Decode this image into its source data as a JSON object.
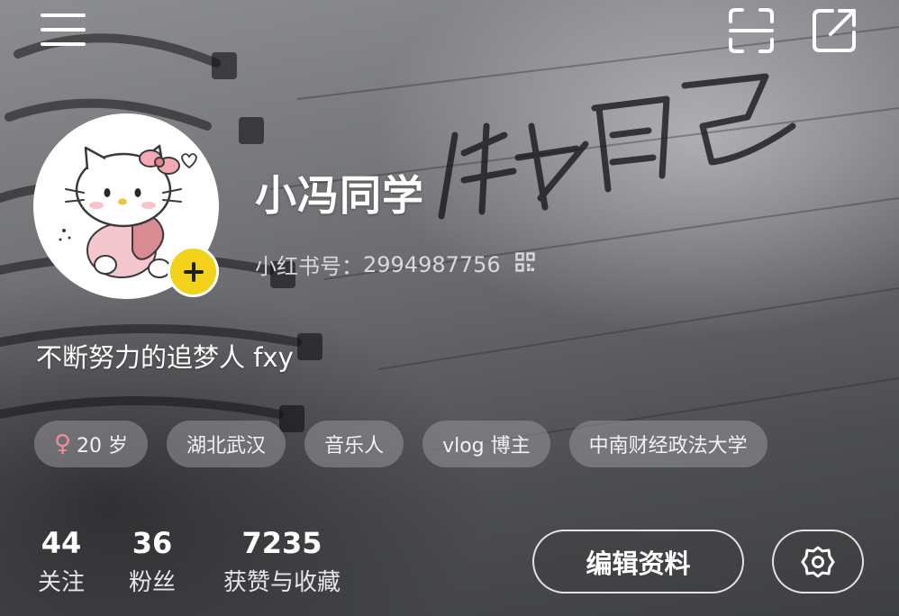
{
  "header": {
    "menu_icon": "hamburger-menu-icon",
    "scan_icon": "scan-icon",
    "share_icon": "share-icon"
  },
  "profile": {
    "username": "小冯同学",
    "id_label": "小红书号：",
    "id_value": "2994987756",
    "bio": "不断努力的追梦人 fxy",
    "avatar_icon": "hello-kitty-avatar",
    "add_icon": "plus-icon",
    "accent_yellow": "#f3d21b"
  },
  "tags": [
    {
      "icon": "female-icon",
      "symbol": "♀",
      "label": "20 岁"
    },
    {
      "label": "湖北武汉"
    },
    {
      "label": "音乐人"
    },
    {
      "label": "vlog 博主"
    },
    {
      "label": "中南财经政法大学"
    }
  ],
  "stats": [
    {
      "value": "44",
      "label": "关注"
    },
    {
      "value": "36",
      "label": "粉丝"
    },
    {
      "value": "7235",
      "label": "获赞与收藏"
    }
  ],
  "actions": {
    "edit_label": "编辑资料",
    "settings_icon": "gear-icon"
  }
}
